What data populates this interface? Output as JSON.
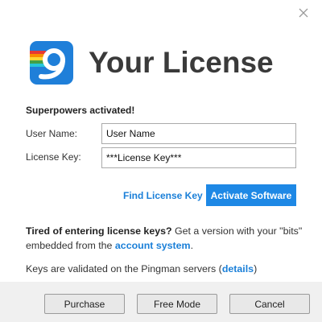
{
  "window": {
    "close_icon": "close-icon"
  },
  "header": {
    "logo_icon": "pingman-logo-icon",
    "title": "Your License"
  },
  "form": {
    "activated_text": "Superpowers activated!",
    "user_name_label": "User Name:",
    "user_name_value": "User Name",
    "license_key_label": "License Key:",
    "license_key_value": "***License Key***"
  },
  "actions": {
    "find_license_key": "Find License Key",
    "activate_software": "Activate Software"
  },
  "info": {
    "tired_bold": "Tired of entering license keys?",
    "tired_rest": " Get a version with your \"bits\" embedded from the ",
    "account_system_link": "account system",
    "period": ".",
    "validated_text": "Keys are validated on the Pingman servers (",
    "details_link": "details",
    "close_paren": ")"
  },
  "footer": {
    "purchase": "Purchase",
    "free_mode": "Free Mode",
    "cancel": "Cancel"
  },
  "colors": {
    "accent": "#1e88e5",
    "link": "#1a7fd8",
    "logo_bg": "#1f7fd9"
  }
}
